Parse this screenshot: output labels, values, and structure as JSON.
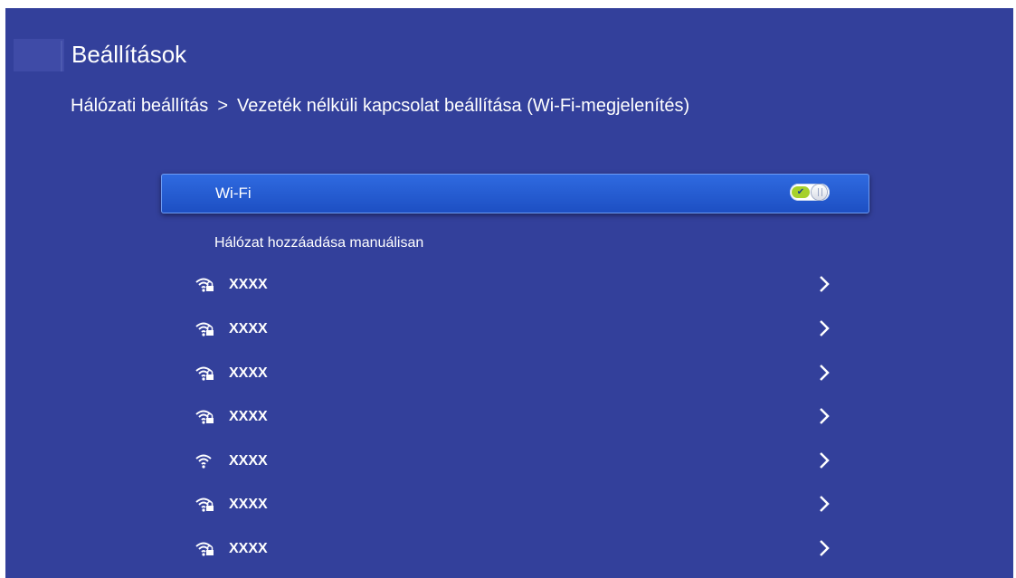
{
  "header": {
    "title": "Beállítások"
  },
  "breadcrumb": {
    "parent": "Hálózati beállítás",
    "separator": ">",
    "current": "Vezeték nélküli kapcsolat beállítása (Wi-Fi-megjelenítés)"
  },
  "wifi_toggle": {
    "label": "Wi-Fi",
    "state": "on",
    "on_color": "#a6d12b"
  },
  "add_network": {
    "label": "Hálózat hozzáadása manuálisan"
  },
  "networks": [
    {
      "ssid": "XXXX",
      "icon": "wifi-lock-icon",
      "secured": true
    },
    {
      "ssid": "XXXX",
      "icon": "wifi-lock-icon",
      "secured": true
    },
    {
      "ssid": "XXXX",
      "icon": "wifi-lock-icon",
      "secured": true
    },
    {
      "ssid": "XXXX",
      "icon": "wifi-lock-icon",
      "secured": true
    },
    {
      "ssid": "XXXX",
      "icon": "wifi-icon",
      "secured": false
    },
    {
      "ssid": "XXXX",
      "icon": "wifi-lock-icon",
      "secured": true
    },
    {
      "ssid": "XXXX",
      "icon": "wifi-lock-icon",
      "secured": true
    }
  ],
  "colors": {
    "background": "#33409b",
    "selected_row": "#2560d6"
  }
}
